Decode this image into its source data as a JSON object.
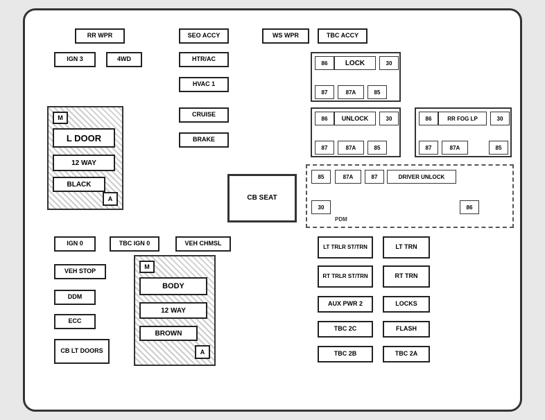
{
  "labels": {
    "rr_wpr": "RR WPR",
    "seo_accy": "SEO ACCY",
    "ws_wpr": "WS WPR",
    "tbc_accy": "TBC ACCY",
    "ign3": "IGN 3",
    "four_wd": "4WD",
    "htr_ac": "HTR/AC",
    "hvac1": "HVAC 1",
    "cruise": "CRUISE",
    "brake": "BRAKE",
    "m_ldoor": "M",
    "l_door": "L DOOR",
    "twelve_way": "12 WAY",
    "black": "BLACK",
    "a_left": "A",
    "cb_seat": "CB\nSEAT",
    "ign0": "IGN 0",
    "tbc_ign0": "TBC IGN 0",
    "veh_chmsl": "VEH CHMSL",
    "veh_stop": "VEH STOP",
    "ddm": "DDM",
    "ecc": "ECC",
    "cb_lt_doors": "CB\nLT DOORS",
    "m_body": "M",
    "body": "BODY",
    "twelve_way_b": "12 WAY",
    "brown": "BROWN",
    "a_right": "A",
    "lt_trlr": "LT TRLR\nST/TRN",
    "lt_trn": "LT TRN",
    "rt_trlr": "RT TRLR\nST/TRN",
    "rt_trn": "RT TRN",
    "aux_pwr2": "AUX PWR 2",
    "locks": "LOCKS",
    "tbc_2c": "TBC 2C",
    "flash": "FLASH",
    "tbc_2b": "TBC 2B",
    "tbc_2a": "TBC 2A",
    "lock_86": "86",
    "lock_30": "30",
    "lock_lock": "LOCK",
    "lock_87": "87",
    "lock_87a": "87A",
    "lock_85": "85",
    "unlock_86": "86",
    "unlock_30": "30",
    "unlock_unlock": "UNLOCK",
    "unlock_87": "87",
    "unlock_87a": "87A",
    "unlock_85": "85",
    "rrfog_86": "86",
    "rrfog_30": "30",
    "rrfog_label": "RR FOG LP",
    "rrfog_87": "87",
    "rrfog_87a": "87A",
    "rrfog_85": "85",
    "du_85": "85",
    "du_87a": "87A",
    "du_87": "87",
    "du_label": "DRIVER UNLOCK",
    "du_30": "30",
    "du_86": "86",
    "pdm": "PDM"
  }
}
